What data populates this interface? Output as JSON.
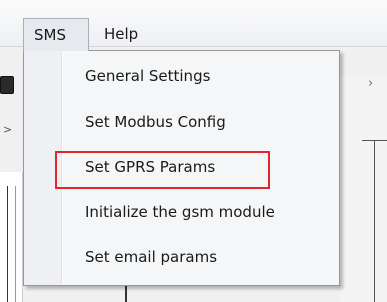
{
  "menubar": {
    "items": [
      {
        "label": "SMS"
      },
      {
        "label": "Help"
      }
    ]
  },
  "dropdown": {
    "items": [
      {
        "label": "General Settings"
      },
      {
        "label": "Set Modbus Config"
      },
      {
        "label": "Set GPRS Params",
        "highlighted": true
      },
      {
        "label": "Initialize the gsm module"
      },
      {
        "label": "Set email params"
      }
    ]
  },
  "colors": {
    "highlight_border": "#e0282c",
    "menu_background": "#f5f6f7",
    "gutter": "#eef0f4"
  }
}
